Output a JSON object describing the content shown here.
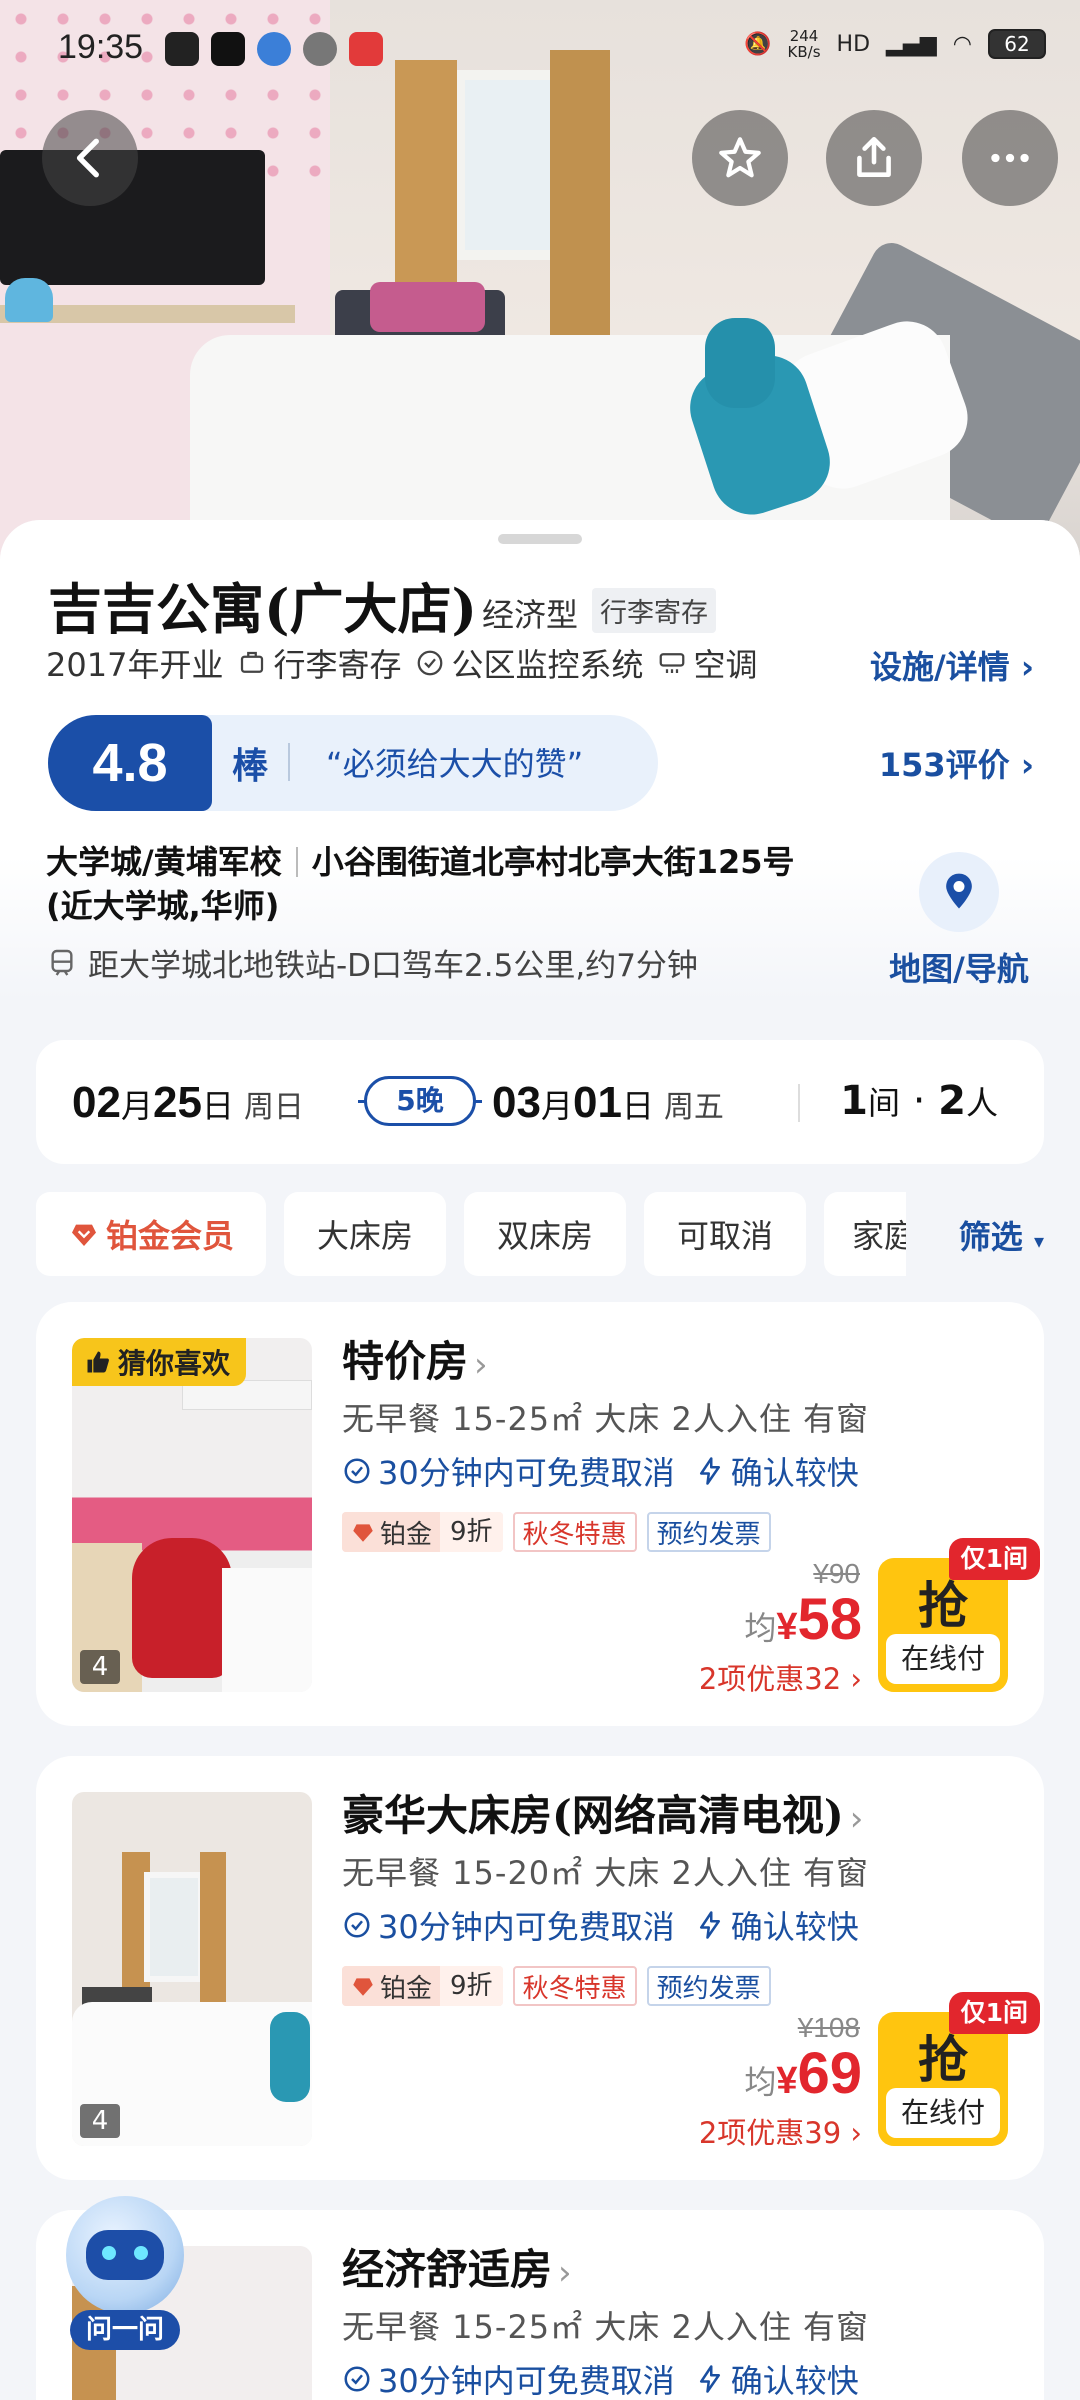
{
  "status_bar": {
    "time": "19:35",
    "net_speed_value": "244",
    "net_speed_unit": "KB/s",
    "battery": "62"
  },
  "hotel": {
    "name": "吉吉公寓(广大店)",
    "type": "经济型",
    "tag": "行李寄存",
    "opened": "2017年开业",
    "facilities": [
      "行李寄存",
      "公区监控系统",
      "空调"
    ],
    "facility_link": "设施/详情",
    "score": "4.8",
    "score_word": "棒",
    "quote": "“必须给大大的赞”",
    "reviews": "153评价",
    "area": "大学城/黄埔军校",
    "address": "小谷围街道北亭村北亭大街125号",
    "address_note": "(近大学城,华师)",
    "metro": "距大学城北地铁站-D口驾车2.5公里,约7分钟",
    "map_label": "地图/导航"
  },
  "booking": {
    "checkin_month": "02",
    "checkin_day": "25",
    "checkin_week": "周日",
    "nights": "5晚",
    "checkout_month": "03",
    "checkout_day": "01",
    "checkout_week": "周五",
    "rooms": "1",
    "rooms_unit": "间",
    "guests": "2",
    "guests_unit": "人",
    "month_char": "月",
    "day_char": "日"
  },
  "filters": {
    "vip": "铂金会员",
    "chips": [
      "大床房",
      "双床房",
      "可取消",
      "家庭"
    ],
    "filter_label": "筛选"
  },
  "rooms": [
    {
      "guess_tag": "猜你喜欢",
      "name": "特价房",
      "photo_count": "4",
      "spec": "无早餐  15-25㎡  大床  2人入住  有窗",
      "cancel": "30分钟内可免费取消",
      "confirm": "确认较快",
      "badge_plat": "铂金",
      "badge_disc": "9折",
      "badge_red": "秋冬特惠",
      "badge_blue": "预约发票",
      "orig_price": "¥90",
      "avg_label": "均",
      "currency": "¥",
      "price": "58",
      "discount": "2项优惠32 ›",
      "grab": "抢",
      "pay": "在线付",
      "only": "仅1间"
    },
    {
      "name": "豪华大床房(网络高清电视)",
      "photo_count": "4",
      "spec": "无早餐  15-20㎡  大床  2人入住  有窗",
      "cancel": "30分钟内可免费取消",
      "confirm": "确认较快",
      "badge_plat": "铂金",
      "badge_disc": "9折",
      "badge_red": "秋冬特惠",
      "badge_blue": "预约发票",
      "orig_price": "¥108",
      "avg_label": "均",
      "currency": "¥",
      "price": "69",
      "discount": "2项优惠39 ›",
      "grab": "抢",
      "pay": "在线付",
      "only": "仅1间"
    },
    {
      "name": "经济舒适房",
      "spec": "无早餐  15-25㎡  大床  2人入住  有窗",
      "cancel": "30分钟内可免费取消",
      "confirm": "确认较快"
    }
  ],
  "assistant": {
    "label": "问一问"
  },
  "colors": {
    "brand_blue": "#1b4fa8",
    "price_red": "#e2262d",
    "grab_yellow": "#ffc50f"
  }
}
